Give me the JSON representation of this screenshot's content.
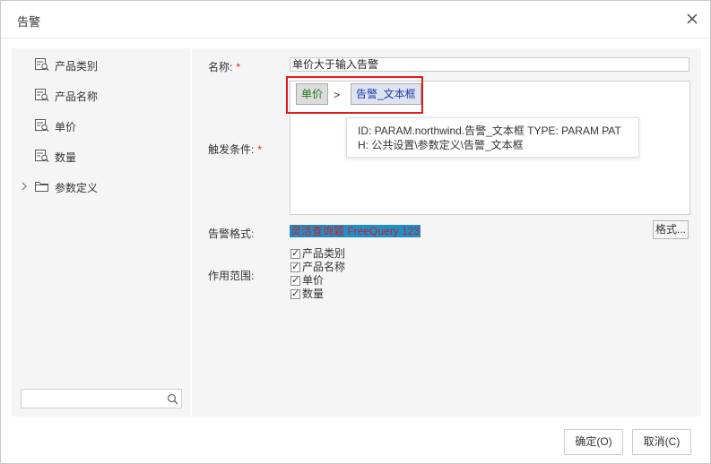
{
  "window": {
    "title": "告警"
  },
  "sidebar": {
    "items": [
      {
        "label": "产品类别",
        "icon": "field-icon"
      },
      {
        "label": "产品名称",
        "icon": "field-icon"
      },
      {
        "label": "单价",
        "icon": "field-icon"
      },
      {
        "label": "数量",
        "icon": "field-icon"
      },
      {
        "label": "参数定义",
        "icon": "folder-icon",
        "expandable": true
      }
    ],
    "search": {
      "value": "",
      "placeholder": ""
    }
  },
  "form": {
    "name_label": "名称:",
    "name_value": "单价大于输入告警",
    "condition_label": "触发条件:",
    "condition": {
      "field": "单价",
      "operator": ">",
      "param": "告警_文本框"
    },
    "tooltip": {
      "line1": "ID: PARAM.northwind.告警_文本框 TYPE: PARAM PAT",
      "line2": "H: 公共设置\\参数定义\\告警_文本框"
    },
    "format_label": "告警格式:",
    "format_preview_a": "灵活查询题",
    "format_preview_b": " FreeQuery 123",
    "format_button": "格式...",
    "scope_label": "作用范围:",
    "scope_items": [
      {
        "label": "产品类别",
        "checked": true
      },
      {
        "label": "产品名称",
        "checked": true
      },
      {
        "label": "单价",
        "checked": true
      },
      {
        "label": "数量",
        "checked": true
      }
    ],
    "required_mark": "*"
  },
  "footer": {
    "ok_label": "确定(O)",
    "cancel_label": "取消(C)"
  },
  "colors": {
    "required": "#e02020",
    "highlight_border": "#e01b1b",
    "format_bg": "#1e90c8",
    "format_text": "#c8202a",
    "field_chip_text": "#1f7a1f",
    "param_chip_text": "#1f3aa8"
  }
}
